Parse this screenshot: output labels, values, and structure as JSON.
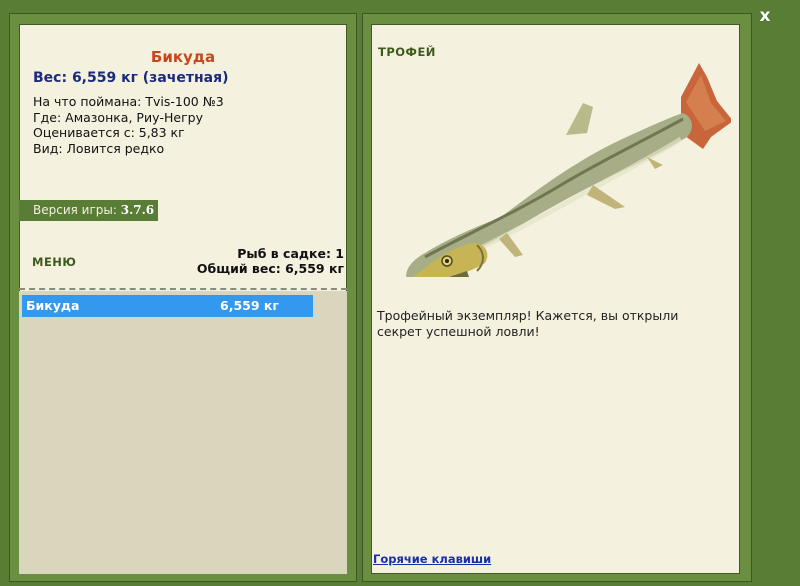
{
  "window": {
    "close_label": "x"
  },
  "fish": {
    "name": "Бикуда",
    "weight_line": "Вес: 6,559 кг (зачетная)",
    "caught_with": "На что поймана: Tvis-100 №3",
    "location": "Где: Амазонка, Риу-Негру",
    "rated_from": "Оценивается с: 5,83 кг",
    "species": "Вид: Ловится редко"
  },
  "version": {
    "label": "Версия игры:",
    "value": "3.7.6"
  },
  "menu": {
    "label": "МЕНЮ"
  },
  "keepnet": {
    "fish_count": "Рыб в садке: 1",
    "total_weight": "Общий вес: 6,559 кг"
  },
  "catch_list": [
    {
      "name": "Бикуда",
      "weight": "6,559 кг"
    }
  ],
  "trophy": {
    "label": "ТРОФЕЙ",
    "description": "Трофейный экземпляр! Кажется, вы открыли секрет успешной ловли!"
  },
  "hotkeys": {
    "label": "Горячие клавиши"
  },
  "colors": {
    "frame": "#5a7d36",
    "panel": "#f4f1df",
    "selected_row": "#3399ee",
    "title": "#c8461d",
    "weight": "#1c2a7a"
  },
  "icons": {
    "close": "close-icon",
    "fish_picture": "fish-image"
  }
}
